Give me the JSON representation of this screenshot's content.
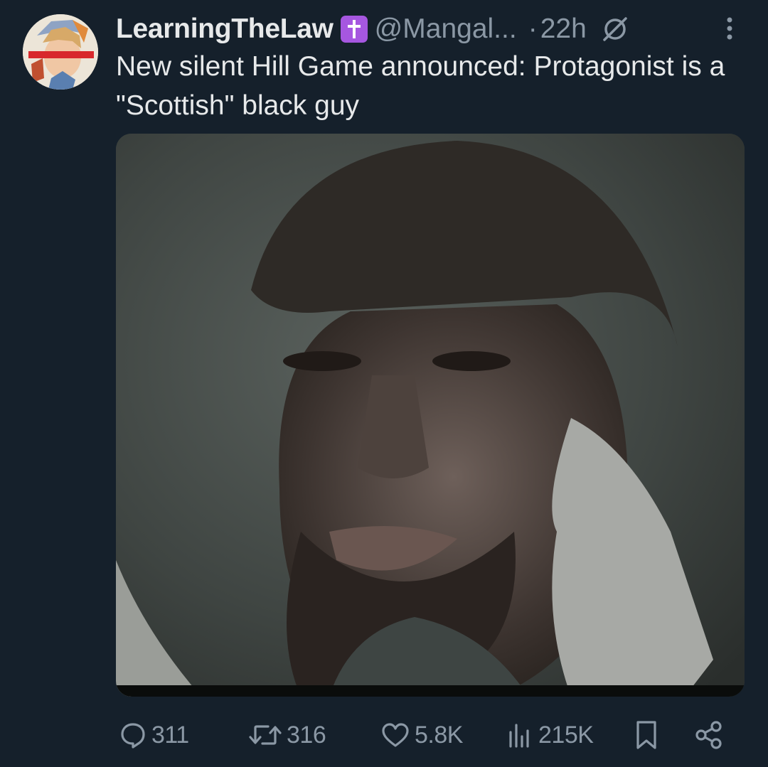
{
  "author": {
    "display_name": "LearningTheLaw",
    "badge_icon": "cross-badge-icon",
    "badge_color": "#a657e0",
    "handle": "@Mangal...",
    "separator": "·",
    "timestamp": "22h"
  },
  "tweet": {
    "text": "New silent Hill Game announced: Protagonist is a \"Scottish\" black guy"
  },
  "actions": {
    "reply_count": "311",
    "retweet_count": "316",
    "like_count": "5.8K",
    "views_count": "215K"
  },
  "colors": {
    "background": "#15202b",
    "primary_text": "#e7e9ea",
    "secondary_text": "#8b98a5"
  }
}
